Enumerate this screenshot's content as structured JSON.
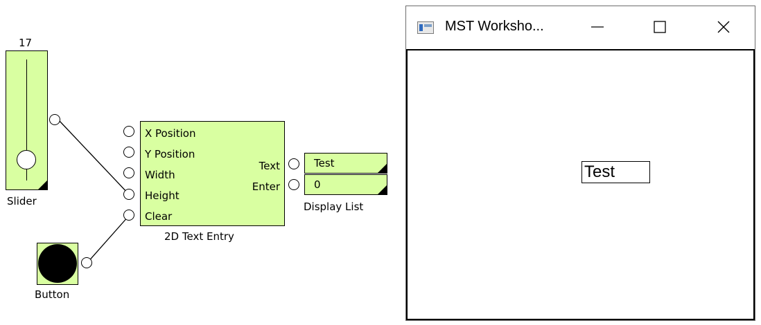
{
  "slider": {
    "value": "17",
    "label": "Slider",
    "level": 0.17
  },
  "button_block": {
    "label": "Button"
  },
  "text_entry_block": {
    "title": "2D Text Entry",
    "inputs": [
      "X Position",
      "Y Position",
      "Width",
      "Height",
      "Clear"
    ],
    "outputs": [
      "Text",
      "Enter"
    ]
  },
  "display_list": {
    "title": "Display List",
    "rows": [
      "Test",
      "0"
    ]
  },
  "window": {
    "title": "MST Worksho...",
    "minimize_glyph": "—",
    "maximize_glyph": "☐",
    "close_glyph": "✕",
    "text_entry_value": "Test"
  },
  "colors": {
    "block_fill": "#d9ffa1",
    "outline": "#000000"
  }
}
